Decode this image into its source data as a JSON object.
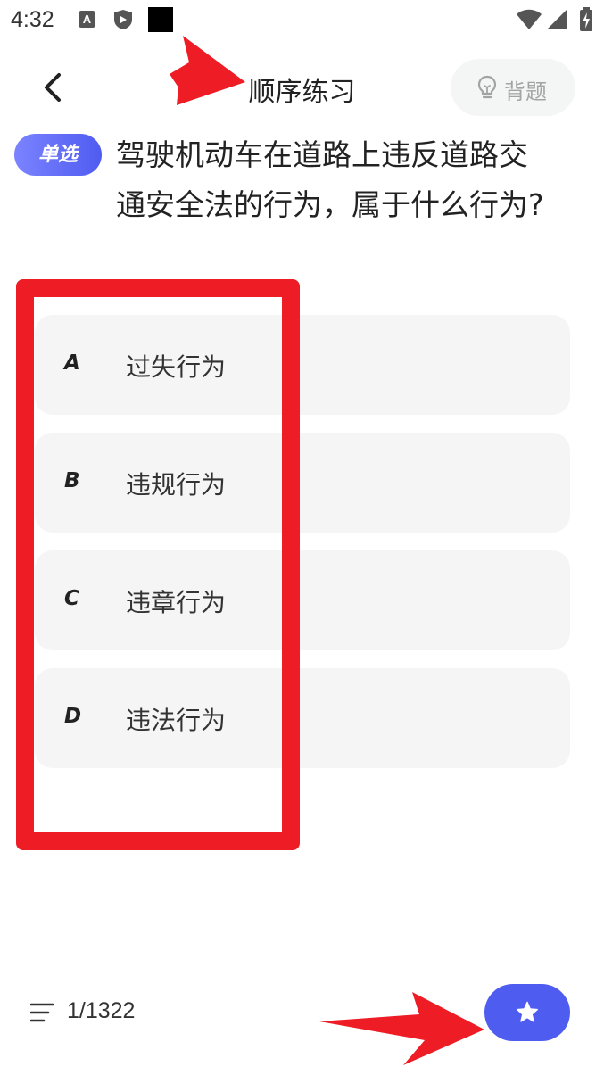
{
  "status_bar": {
    "time": "4:32",
    "icons": [
      "a-icon",
      "shield-icon",
      "black-square-icon",
      "wifi-icon",
      "signal-icon",
      "battery-charging-icon"
    ]
  },
  "header": {
    "title": "顺序练习",
    "back_icon": "chevron-left-icon",
    "recite_label": "背题",
    "recite_icon": "lightbulb-icon"
  },
  "question": {
    "type_label": "单选",
    "text": "驾驶机动车在道路上违反道路交通安全法的行为，属于什么行为?"
  },
  "options": [
    {
      "letter": "A",
      "text": "过失行为"
    },
    {
      "letter": "B",
      "text": "违规行为"
    },
    {
      "letter": "C",
      "text": "违章行为"
    },
    {
      "letter": "D",
      "text": "违法行为"
    }
  ],
  "footer": {
    "list_icon": "list-icon",
    "progress": "1/1322",
    "favorite_icon": "star-icon"
  },
  "colors": {
    "accent": "#4f5cf0",
    "badge_gradient_start": "#7b83ff",
    "option_bg": "#f5f5f5",
    "annotation_red": "#ee1c25"
  }
}
